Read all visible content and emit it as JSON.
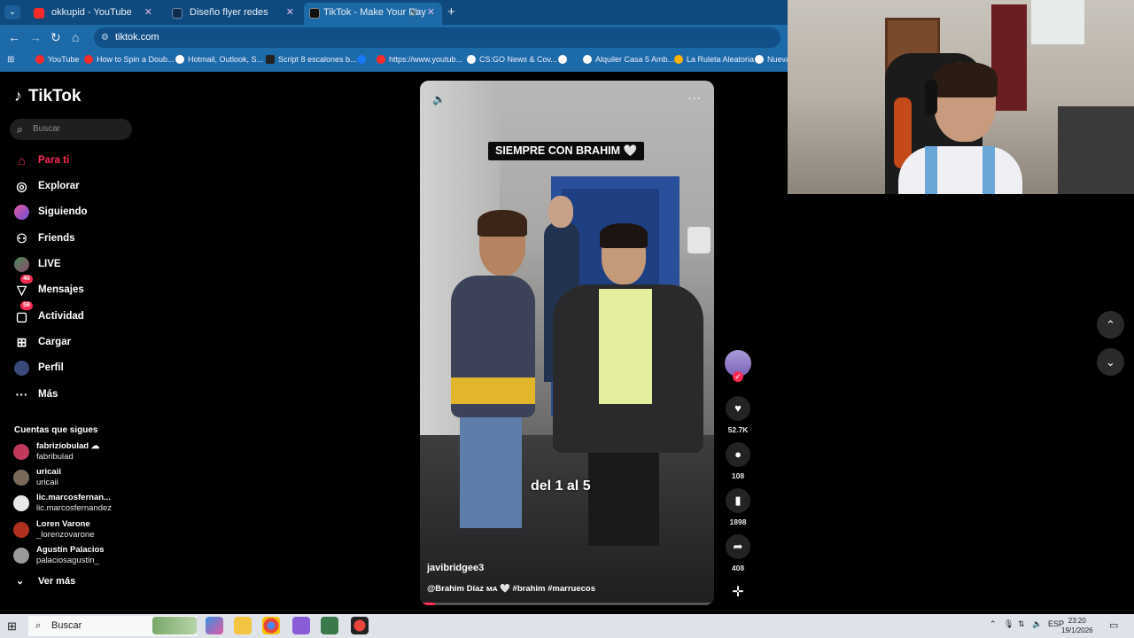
{
  "browser": {
    "tabs": [
      {
        "title": "okkupid - YouTube",
        "color": "#ff2a2a"
      },
      {
        "title": "Diseño flyer redes sociales",
        "color": "#0f2b4f"
      },
      {
        "title": "TikTok - Make Your Day",
        "color": "#111111"
      }
    ],
    "url": "tiktok.com",
    "bookmarks": [
      {
        "label": "YouTube",
        "color": "#ff2a2a"
      },
      {
        "label": "How to Spin a Doub...",
        "color": "#ff2a2a"
      },
      {
        "label": "Hotmail, Outlook, S...",
        "color": "#ffffff"
      },
      {
        "label": "Script 8 escalones b...",
        "color": "#222222"
      },
      {
        "label": "",
        "color": "#1877f2"
      },
      {
        "label": "https://www.youtub...",
        "color": "#ff2a2a"
      },
      {
        "label": "CS:GO News & Cov...",
        "color": "#ffffff"
      },
      {
        "label": "",
        "color": "#ffffff"
      },
      {
        "label": "Alquiler Casa 5 Amb...",
        "color": "#ffffff"
      },
      {
        "label": "La Ruleta Aleatoria",
        "color": "#ffb000"
      },
      {
        "label": "Nueva",
        "color": "#ffffff"
      }
    ]
  },
  "tiktok": {
    "logo": "TikTok",
    "search_placeholder": "Buscar",
    "nav": [
      {
        "label": "Para ti",
        "icon": "home-icon",
        "glyph": "⌂"
      },
      {
        "label": "Explorar",
        "icon": "compass-icon",
        "glyph": "◎"
      },
      {
        "label": "Siguiendo",
        "icon": "following-icon",
        "glyph": "●"
      },
      {
        "label": "Friends",
        "icon": "friends-icon",
        "glyph": "⚇"
      },
      {
        "label": "LIVE",
        "icon": "live-icon",
        "glyph": "●"
      },
      {
        "label": "Mensajes",
        "icon": "messages-icon",
        "glyph": "▽",
        "badge": "40"
      },
      {
        "label": "Actividad",
        "icon": "activity-icon",
        "glyph": "▢",
        "badge": "58"
      },
      {
        "label": "Cargar",
        "icon": "upload-icon",
        "glyph": "⊞"
      },
      {
        "label": "Perfil",
        "icon": "profile-icon",
        "glyph": "●"
      },
      {
        "label": "Más",
        "icon": "more-icon",
        "glyph": "···"
      }
    ],
    "following_title": "Cuentas que sigues",
    "accounts": [
      {
        "name": "fabriziobulad ☁",
        "handle": "fabribulad",
        "color": "#c0395a"
      },
      {
        "name": "uricaii",
        "handle": "uricaii",
        "color": "#7a6a5a"
      },
      {
        "name": "lic.marcosfernan...",
        "handle": "lic.marcosfernandez",
        "color": "#e8e8e8"
      },
      {
        "name": "Loren Varone",
        "handle": "_lorenzovarone",
        "color": "#b03020"
      },
      {
        "name": "Agustín Palacios",
        "handle": "palaciosagustin_",
        "color": "#9a9a9a"
      }
    ],
    "see_more": "Ver más"
  },
  "video": {
    "caption_top": "SIEMPRE CON BRAHIM 🤍",
    "caption_mid": "del 1 al 5",
    "author": "javibridgee3",
    "description": "@Brahim Díaz ᴍᴀ 🤍 #brahim #marruecos",
    "progress": 0.05
  },
  "actions": {
    "likes": "52.7K",
    "comments": "108",
    "saves": "1898",
    "shares": "408"
  },
  "taskbar": {
    "search_placeholder": "Buscar",
    "lang": "ESP",
    "time": "23:20",
    "date": "19/1/2026"
  }
}
